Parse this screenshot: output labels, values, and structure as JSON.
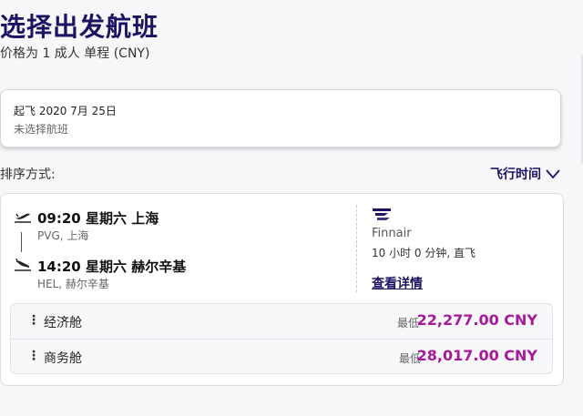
{
  "header": {
    "title": "选择出发航班",
    "subtitle": "价格为 1 成人 单程 (CNY)"
  },
  "departure": {
    "date_line": "起飞 2020 7月 25日",
    "status_line": "未选择航班"
  },
  "sort": {
    "label": "排序方式:",
    "value": "飞行时间"
  },
  "flight": {
    "depart": {
      "time_line": "09:20 星期六 上海",
      "code_line": "PVG, 上海"
    },
    "arrive": {
      "time_line": "14:20 星期六 赫尔辛基",
      "code_line": "HEL, 赫尔辛基"
    },
    "airline": "Finnair",
    "duration": "10 小时 0 分钟, 直飞",
    "details_link": "查看详情",
    "fares": [
      {
        "name": "经济舱",
        "min_label": "最低",
        "price": "22,277.00 CNY"
      },
      {
        "name": "商务舱",
        "min_label": "最低",
        "price": "28,017.00 CNY"
      }
    ]
  },
  "colors": {
    "brand_navy": "#1b1464",
    "price_magenta": "#a8199a"
  },
  "icons": [
    "takeoff-icon",
    "landing-icon",
    "chevron-down-icon",
    "finnair-logo-icon",
    "more-vertical-icon"
  ]
}
